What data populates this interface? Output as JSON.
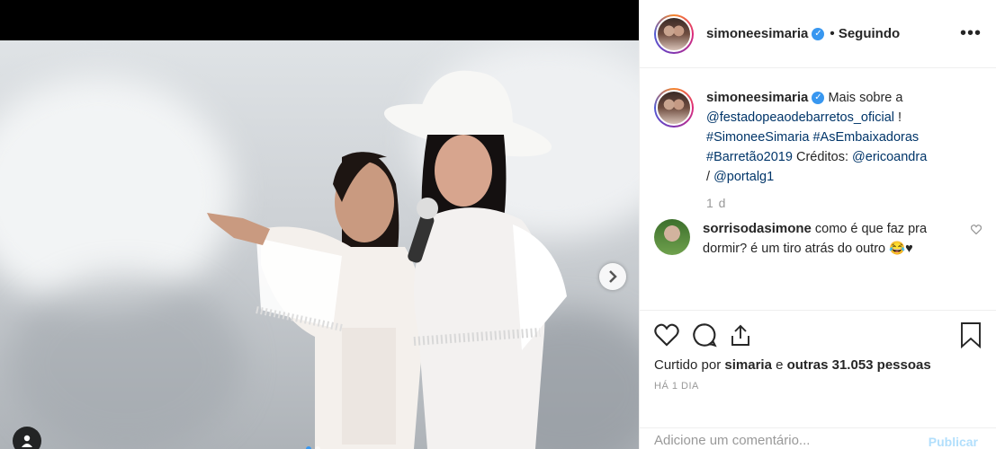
{
  "post": {
    "username": "simoneesimaria",
    "follow_status": "• Seguindo",
    "caption": {
      "author": "simoneesimaria",
      "parts": [
        {
          "text": "Mais sobre a",
          "type": "text"
        },
        {
          "text": "@festadopeaodebarretos_oficial",
          "type": "link"
        },
        {
          "text": " !",
          "type": "text"
        },
        {
          "text": "#SimoneeSimaria",
          "type": "link"
        },
        {
          "text": "#AsEmbaixadoras",
          "type": "link"
        },
        {
          "text": "#Barretão2019",
          "type": "link"
        },
        {
          "text": " Créditos: ",
          "type": "text"
        },
        {
          "text": "@ericoandra",
          "type": "link"
        },
        {
          "text": "/ ",
          "type": "text"
        },
        {
          "text": "@portalg1",
          "type": "link"
        }
      ],
      "age": "1 d"
    },
    "comments": [
      {
        "username": "sorrisodasimone",
        "text": "como é que faz pra dormir? é um tiro atrás do outro 😂♥"
      }
    ],
    "likes_text": {
      "prefix": "Curtido por",
      "user": "simaria",
      "middle": "e",
      "others": "outras 31.053 pessoas"
    },
    "date": "HÁ 1 DIA",
    "comment_placeholder": "Adicione um comentário...",
    "publish_label": "Publicar"
  },
  "icons": {
    "next": "chevron-right-icon",
    "tag": "user-tag-icon",
    "verified": "verified-badge-icon",
    "more": "more-options-icon",
    "like": "heart-icon",
    "comment": "comment-icon",
    "share": "share-icon",
    "save": "bookmark-icon"
  },
  "carousel": {
    "total": 2,
    "active": 1
  },
  "colors": {
    "link": "#003569",
    "verified": "#3897f0",
    "publish": "#b2dffc"
  }
}
